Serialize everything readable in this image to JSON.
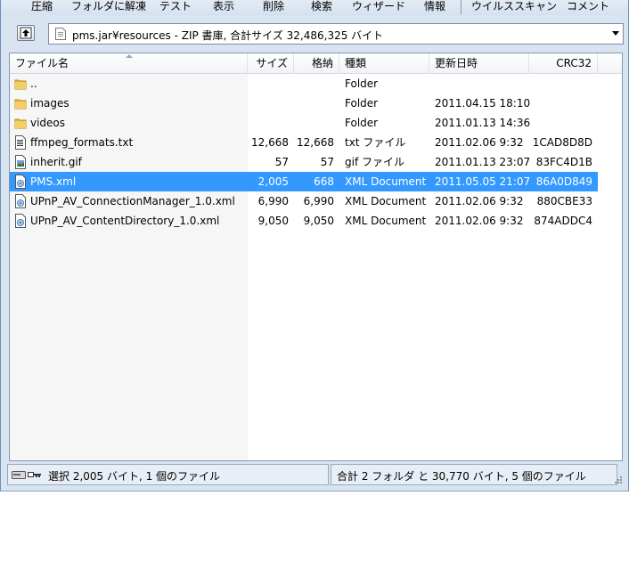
{
  "toolbar": {
    "items": [
      "圧縮",
      "フォルダに解凍",
      "テスト",
      "表示",
      "削除",
      "検索",
      "ウィザード",
      "情報",
      "ウイルススキャン",
      "コメント"
    ]
  },
  "address": {
    "path": "pms.jar¥resources - ZIP 書庫, 合計サイズ 32,486,325 バイト"
  },
  "columns": {
    "name": "ファイル名",
    "size": "サイズ",
    "packed": "格納",
    "type": "種類",
    "modified": "更新日時",
    "crc": "CRC32"
  },
  "files": [
    {
      "name": "..",
      "icon": "folder-icon",
      "size": "",
      "packed": "",
      "type": "Folder",
      "modified": "",
      "crc": ""
    },
    {
      "name": "images",
      "icon": "folder-icon",
      "size": "",
      "packed": "",
      "type": "Folder",
      "modified": "2011.04.15 18:10",
      "crc": ""
    },
    {
      "name": "videos",
      "icon": "folder-icon",
      "size": "",
      "packed": "",
      "type": "Folder",
      "modified": "2011.01.13 14:36",
      "crc": ""
    },
    {
      "name": "ffmpeg_formats.txt",
      "icon": "text-file-icon",
      "size": "12,668",
      "packed": "12,668",
      "type": "txt ファイル",
      "modified": "2011.02.06 9:32",
      "crc": "1CAD8D8D"
    },
    {
      "name": "inherit.gif",
      "icon": "image-file-icon",
      "size": "57",
      "packed": "57",
      "type": "gif ファイル",
      "modified": "2011.01.13 23:07",
      "crc": "83FC4D1B"
    },
    {
      "name": "PMS.xml",
      "icon": "xml-file-icon",
      "size": "2,005",
      "packed": "668",
      "type": "XML Document",
      "modified": "2011.05.05 21:07",
      "crc": "86A0D849",
      "selected": true
    },
    {
      "name": "UPnP_AV_ConnectionManager_1.0.xml",
      "icon": "xml-file-icon",
      "size": "6,990",
      "packed": "6,990",
      "type": "XML Document",
      "modified": "2011.02.06 9:32",
      "crc": "880CBE33"
    },
    {
      "name": "UPnP_AV_ContentDirectory_1.0.xml",
      "icon": "xml-file-icon",
      "size": "9,050",
      "packed": "9,050",
      "type": "XML Document",
      "modified": "2011.02.06 9:32",
      "crc": "874ADDC4"
    }
  ],
  "status": {
    "selection": "選択 2,005 バイト, 1 個のファイル",
    "total": "合計 2 フォルダ と 30,770 バイト, 5 個のファイル"
  },
  "colors": {
    "selection": "#3399ff",
    "window_bg": "#d9e4f1"
  }
}
